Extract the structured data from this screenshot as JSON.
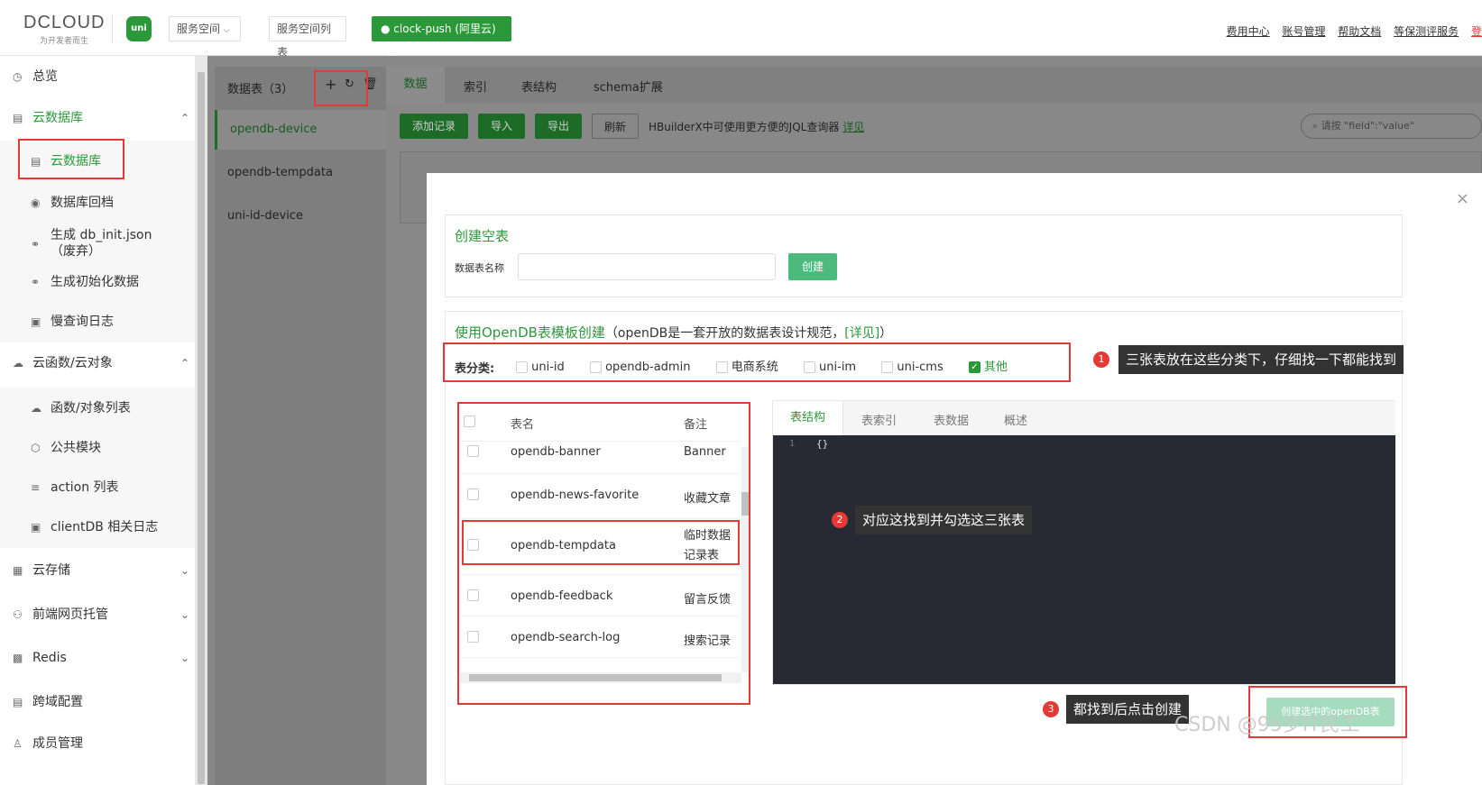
{
  "topbar": {
    "logo": "DCLOUD",
    "logo_sub": "为开发者而生",
    "uni_logo": "uni",
    "space_select": "服务空间",
    "space_list": "服务空间列表",
    "current_space": "clock-push (阿里云)",
    "links": [
      "费用中心",
      "账号管理",
      "帮助文档",
      "等保测评服务",
      "登"
    ]
  },
  "sidebar": {
    "items": [
      {
        "icon": "dashboard-icon",
        "glyph": "◷",
        "label": "总览"
      },
      {
        "icon": "database-icon",
        "glyph": "▤",
        "label": "云数据库"
      },
      {
        "icon": "database-icon",
        "glyph": "▤",
        "label": "云数据库"
      },
      {
        "icon": "backup-icon",
        "glyph": "◉",
        "label": "数据库回档"
      },
      {
        "icon": "link-icon",
        "glyph": "⚭",
        "label": "生成 db_init.json（废弃）"
      },
      {
        "icon": "link-icon",
        "glyph": "⚭",
        "label": "生成初始化数据"
      },
      {
        "icon": "log-icon",
        "glyph": "▣",
        "label": "慢查询日志"
      },
      {
        "icon": "cloud-icon",
        "glyph": "☁",
        "label": "云函数/云对象"
      },
      {
        "icon": "cloud-icon",
        "glyph": "☁",
        "label": "函数/对象列表"
      },
      {
        "icon": "cube-icon",
        "glyph": "⬡",
        "label": "公共模块"
      },
      {
        "icon": "list-icon",
        "glyph": "≡",
        "label": "action 列表"
      },
      {
        "icon": "log-icon",
        "glyph": "▣",
        "label": "clientDB 相关日志"
      },
      {
        "icon": "storage-icon",
        "glyph": "▦",
        "label": "云存储"
      },
      {
        "icon": "web-icon",
        "glyph": "⚇",
        "label": "前端网页托管"
      },
      {
        "icon": "redis-icon",
        "glyph": "▩",
        "label": "Redis"
      },
      {
        "icon": "cross-domain-icon",
        "glyph": "▤",
        "label": "跨域配置"
      },
      {
        "icon": "user-icon",
        "glyph": "♙",
        "label": "成员管理"
      }
    ]
  },
  "db": {
    "panel_title": "数据表（3）",
    "tables": [
      "opendb-device",
      "opendb-tempdata",
      "uni-id-device"
    ],
    "tabs": [
      "数据",
      "索引",
      "表结构",
      "schema扩展"
    ],
    "actions": [
      "添加记录",
      "导入",
      "导出",
      "刷新"
    ],
    "hint": "HBuilderX中可使用更方便的JQL查询器",
    "hint_link": "详见",
    "search_placeholder": "请按 \"field\":\"value\""
  },
  "modal": {
    "empty_title": "创建空表",
    "name_label": "数据表名称",
    "create_btn": "创建",
    "template_title": "使用OpenDB表模板创建",
    "template_desc": "（openDB是一套开放的数据表设计规范，",
    "template_link": "[详见]",
    "template_close": "）",
    "category_label": "表分类:",
    "categories": [
      {
        "label": "uni-id",
        "checked": false
      },
      {
        "label": "opendb-admin",
        "checked": false
      },
      {
        "label": "电商系统",
        "checked": false
      },
      {
        "label": "uni-im",
        "checked": false
      },
      {
        "label": "uni-cms",
        "checked": false
      },
      {
        "label": "其他",
        "checked": true
      }
    ],
    "table_headers": [
      "表名",
      "备注"
    ],
    "rows": [
      {
        "name": "opendb-banner",
        "note": "Banner"
      },
      {
        "name": "opendb-news-favorite",
        "note": "收藏文章"
      },
      {
        "name": "opendb-tempdata",
        "note": "临时数据记录表"
      },
      {
        "name": "opendb-feedback",
        "note": "留言反馈"
      },
      {
        "name": "opendb-search-log",
        "note": "搜索记录"
      }
    ],
    "detail_tabs": [
      "表结构",
      "表索引",
      "表数据",
      "概述"
    ],
    "code_line_no": "1",
    "code_text": "{}",
    "submit_btn": "创建选中的openDB表"
  },
  "annotations": {
    "a1": "三张表放在这些分类下，仔细找一下都能找到",
    "a2": "对应这找到并勾选这三张表",
    "a3": "都找到后点击创建",
    "n1": "1",
    "n2": "2",
    "n3": "3"
  },
  "watermark": "CSDN @95岁IT民工"
}
